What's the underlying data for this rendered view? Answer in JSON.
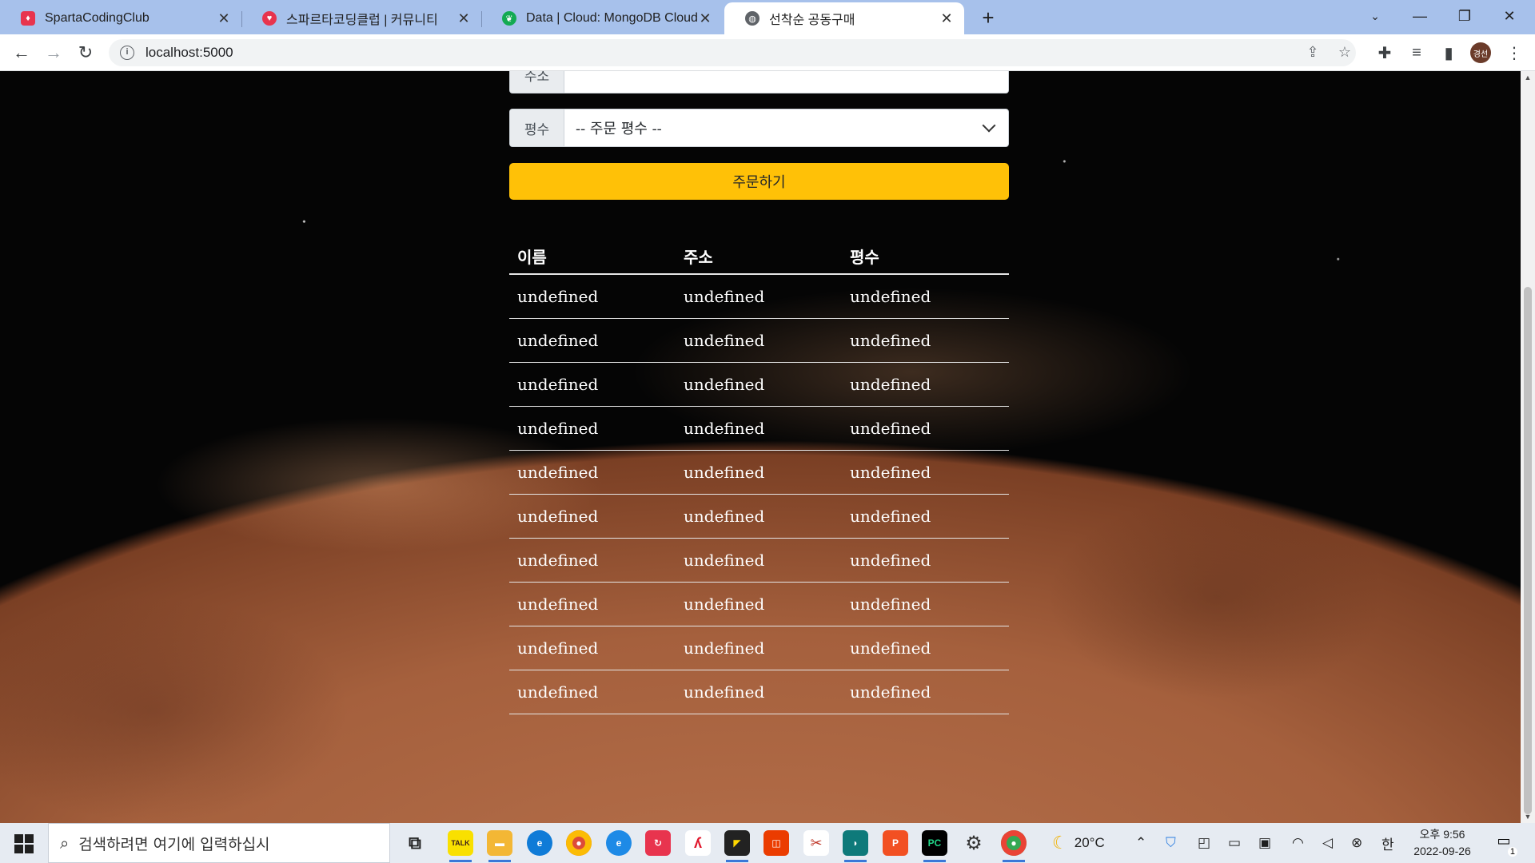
{
  "browser": {
    "tabs": [
      {
        "title": "SpartaCodingClub",
        "favicon_color": "#e8344e",
        "active": false
      },
      {
        "title": "스파르타코딩클럽 | 커뮤니티",
        "favicon_color": "#e8344e",
        "active": false
      },
      {
        "title": "Data | Cloud: MongoDB Cloud",
        "favicon_color": "#13aa52",
        "active": false
      },
      {
        "title": "선착순 공동구매",
        "favicon_color": "#5f6368",
        "active": true
      }
    ],
    "close_glyph": "✕",
    "new_tab_glyph": "+",
    "url": "localhost:5000",
    "profile_label": "경선"
  },
  "form": {
    "address_label": "주소",
    "address_value": "",
    "size_label": "평수",
    "size_selected": "-- 주문 평수 --",
    "order_button": "주문하기"
  },
  "table": {
    "headers": [
      "이름",
      "주소",
      "평수"
    ],
    "rows": [
      [
        "undefined",
        "undefined",
        "undefined"
      ],
      [
        "undefined",
        "undefined",
        "undefined"
      ],
      [
        "undefined",
        "undefined",
        "undefined"
      ],
      [
        "undefined",
        "undefined",
        "undefined"
      ],
      [
        "undefined",
        "undefined",
        "undefined"
      ],
      [
        "undefined",
        "undefined",
        "undefined"
      ],
      [
        "undefined",
        "undefined",
        "undefined"
      ],
      [
        "undefined",
        "undefined",
        "undefined"
      ],
      [
        "undefined",
        "undefined",
        "undefined"
      ],
      [
        "undefined",
        "undefined",
        "undefined"
      ]
    ]
  },
  "taskbar": {
    "search_placeholder": "검색하려면 여기에 입력하십시",
    "weather": "20°C",
    "ime": "한",
    "time": "오후 9:56",
    "date": "2022-09-26",
    "notification_count": "1"
  },
  "colors": {
    "accent_button": "#ffc107",
    "tab_strip": "#a7c1eb"
  }
}
